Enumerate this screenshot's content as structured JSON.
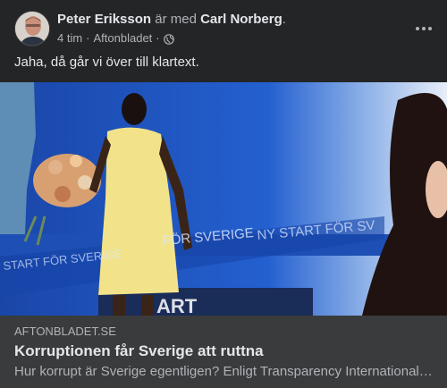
{
  "post": {
    "author": "Peter Eriksson",
    "with_text": "är med",
    "tagged": "Carl Norberg",
    "suffix": ".",
    "time": "4 tim",
    "separator": "·",
    "source": "Aftonbladet",
    "privacy_icon": "globe-icon",
    "more_icon": "more-options-icon",
    "text": "Jaha, då går vi över till klartext."
  },
  "media": {
    "banner_text_1": "FÖR SVERIGE",
    "banner_text_2": "NY START FÖR SV",
    "banner_text_3": "START FÖR SVERIGE",
    "podium_text": "ART",
    "accent_color": "#1d4fb8"
  },
  "link": {
    "domain": "AFTONBLADET.SE",
    "title": "Korruptionen får Sverige att ruttna",
    "description": "Hur korrupt är Sverige egentligen? Enligt Transparency International…"
  }
}
